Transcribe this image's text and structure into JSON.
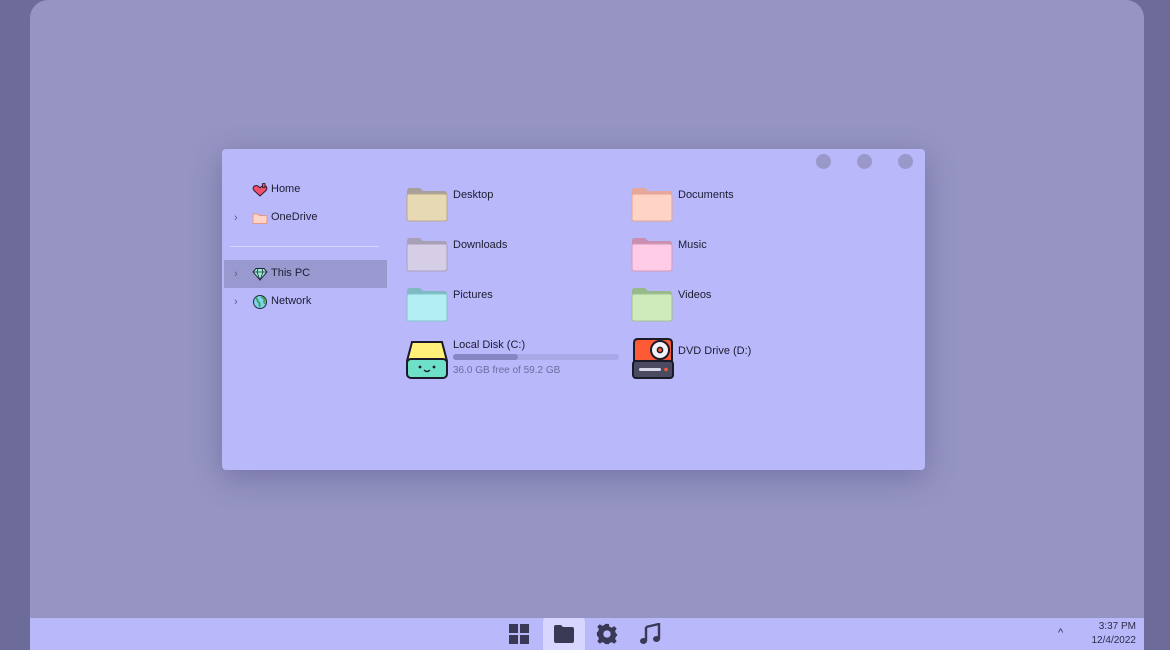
{
  "nav": {
    "items": [
      {
        "label": "Home",
        "icon": "home-heart-icon",
        "chevron": false
      },
      {
        "label": "OneDrive",
        "icon": "folder-icon",
        "chevron": true
      },
      {
        "label": "This PC",
        "icon": "gem-icon",
        "chevron": true,
        "selected": true
      },
      {
        "label": "Network",
        "icon": "globe-icon",
        "chevron": true
      }
    ]
  },
  "content": {
    "folders": [
      {
        "label": "Desktop",
        "color": "#e8d9b5"
      },
      {
        "label": "Documents",
        "color": "#ffd4c7"
      },
      {
        "label": "Downloads",
        "color": "#d6cde6"
      },
      {
        "label": "Music",
        "color": "#ffcbe6"
      },
      {
        "label": "Pictures",
        "color": "#b3eef3"
      },
      {
        "label": "Videos",
        "color": "#cfebbc"
      }
    ],
    "drives": [
      {
        "label": "Local Disk (C:)",
        "sub": "36.0 GB free of 59.2 GB",
        "used_fraction": 0.39,
        "icon": "hard-drive-icon"
      },
      {
        "label": "DVD Drive (D:)",
        "icon": "dvd-drive-icon"
      }
    ]
  },
  "taskbar": {
    "apps": [
      "start-icon",
      "folder-icon",
      "gear-icon",
      "music-note-icon"
    ],
    "active_app": "folder-icon",
    "tray_chevron": "^",
    "time": "3:37 PM",
    "date": "12/4/2022"
  },
  "colors": {
    "desktop": "#9594c2",
    "window": "#b9b8fb",
    "selected": "#9a99cf",
    "accent": "#8786c4"
  }
}
